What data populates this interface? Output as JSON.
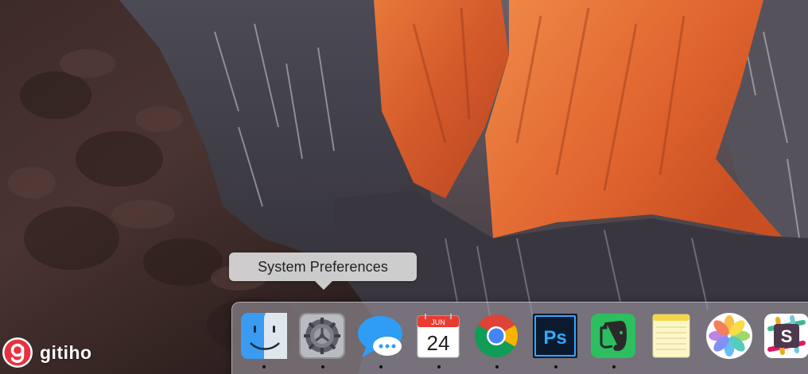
{
  "tooltip": {
    "text": "System Preferences"
  },
  "dock": {
    "items": [
      {
        "name": "finder-icon",
        "running": true
      },
      {
        "name": "system-preferences-icon",
        "running": true
      },
      {
        "name": "messages-icon",
        "running": true
      },
      {
        "name": "calendar-icon",
        "running": true,
        "month": "JUN",
        "day": "24"
      },
      {
        "name": "chrome-icon",
        "running": true
      },
      {
        "name": "photoshop-icon",
        "running": true,
        "label": "Ps"
      },
      {
        "name": "evernote-icon",
        "running": true
      },
      {
        "name": "notes-icon",
        "running": false
      },
      {
        "name": "photos-icon",
        "running": false
      },
      {
        "name": "slack-icon",
        "running": false,
        "label": "S"
      }
    ]
  },
  "watermark": {
    "text": "gitiho"
  },
  "colors": {
    "tooltip_bg": "#d8d8d8",
    "watermark_red": "#e8313f",
    "photoshop_blue": "#31a8ff",
    "evernote_green": "#2dbe60",
    "chrome_red": "#db4437",
    "chrome_green": "#0f9d58",
    "chrome_yellow": "#f4b400",
    "chrome_blue": "#4285f4"
  }
}
